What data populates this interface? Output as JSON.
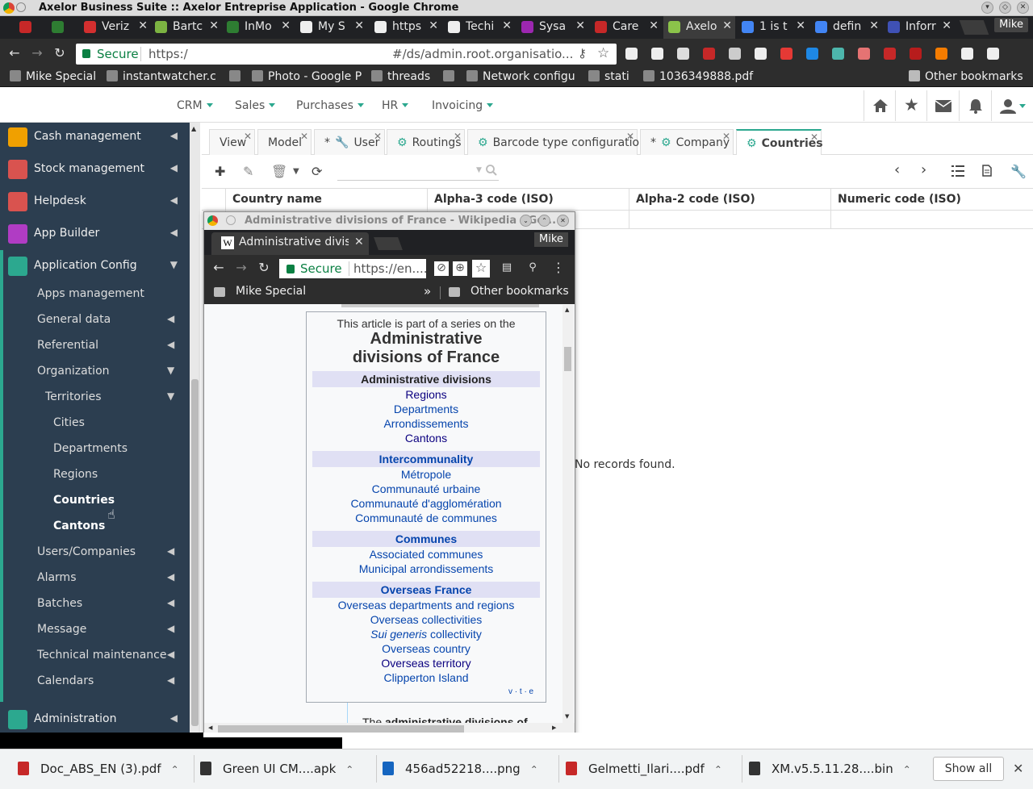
{
  "window": {
    "title": "Axelor Business Suite :: Axelor Entreprise Application - Google Chrome"
  },
  "browser_tabs": [
    {
      "label": "",
      "icon": "gmail-icon",
      "color": "#c62828"
    },
    {
      "label": "",
      "icon": "hangouts-icon",
      "color": "#2e7d32"
    },
    {
      "label": "Veriz",
      "icon": "verizon-icon",
      "color": "#d32f2f"
    },
    {
      "label": "Bartc",
      "icon": "figure-icon",
      "color": "#7cb342"
    },
    {
      "label": "InMo",
      "icon": "inmo-icon",
      "color": "#2e7d32"
    },
    {
      "label": "My S",
      "icon": "briefcase-icon",
      "color": "#eeeeee"
    },
    {
      "label": "https",
      "icon": "page-icon",
      "color": "#eeeeee"
    },
    {
      "label": "Techi",
      "icon": "briefcase-icon",
      "color": "#eeeeee"
    },
    {
      "label": "Sysa",
      "icon": "sysaid-icon",
      "color": "#9c27b0"
    },
    {
      "label": "Care",
      "icon": "info-icon",
      "color": "#c62828"
    },
    {
      "label": "Axelo",
      "icon": "axelor-icon",
      "color": "#8bc34a"
    },
    {
      "label": "1 is t",
      "icon": "google-icon",
      "color": "#4285f4"
    },
    {
      "label": "defin",
      "icon": "google-icon",
      "color": "#4285f4"
    },
    {
      "label": "Inforr",
      "icon": "page-icon",
      "color": "#3f51b5"
    }
  ],
  "profile": "Mike",
  "omnibox": {
    "secure": "Secure",
    "url": "https:/",
    "path": "#/ds/admin.root.organisatio..."
  },
  "bookmarks": [
    {
      "label": "Mike Special",
      "icon": "folder-icon"
    },
    {
      "label": "instantwatcher.c",
      "icon": "w-icon"
    },
    {
      "label": "",
      "icon": "pinwheel-icon"
    },
    {
      "label": "Photo - Google P",
      "icon": "photos-icon"
    },
    {
      "label": "threads",
      "icon": "threads-icon"
    },
    {
      "label": "",
      "icon": "cisco-icon"
    },
    {
      "label": "Network configu",
      "icon": "network-icon"
    },
    {
      "label": "stati",
      "icon": "bug-icon"
    },
    {
      "label": "1036349888.pdf",
      "icon": "page-icon"
    }
  ],
  "other_bookmarks": "Other bookmarks",
  "app_menu": [
    "CRM",
    "Sales",
    "Purchases",
    "HR",
    "Invoicing"
  ],
  "sidebar_top": [
    {
      "label": "Cash management",
      "color": "#f0a000",
      "arrow": "◀"
    },
    {
      "label": "Stock management",
      "color": "#d9534f",
      "arrow": "◀"
    },
    {
      "label": "Helpdesk",
      "color": "#d9534f",
      "arrow": "◀"
    },
    {
      "label": "App Builder",
      "color": "#b03cc4",
      "arrow": "◀"
    },
    {
      "label": "Application Config",
      "color": "#2ca88f",
      "arrow": "▼"
    }
  ],
  "sidebar_sub": [
    {
      "label": "Apps management",
      "indent": 1,
      "arrow": ""
    },
    {
      "label": "General data",
      "indent": 1,
      "arrow": "◀"
    },
    {
      "label": "Referential",
      "indent": 1,
      "arrow": "◀"
    },
    {
      "label": "Organization",
      "indent": 1,
      "arrow": "▼"
    },
    {
      "label": "Territories",
      "indent": 2,
      "arrow": "▼"
    },
    {
      "label": "Cities",
      "indent": 3,
      "arrow": ""
    },
    {
      "label": "Departments",
      "indent": 3,
      "arrow": ""
    },
    {
      "label": "Regions",
      "indent": 3,
      "arrow": ""
    },
    {
      "label": "Countries",
      "indent": 3,
      "arrow": "",
      "bold": true
    },
    {
      "label": "Cantons",
      "indent": 3,
      "arrow": "",
      "bold": true
    },
    {
      "label": "Users/Companies",
      "indent": 1,
      "arrow": "◀"
    },
    {
      "label": "Alarms",
      "indent": 1,
      "arrow": "◀"
    },
    {
      "label": "Batches",
      "indent": 1,
      "arrow": "◀"
    },
    {
      "label": "Message",
      "indent": 1,
      "arrow": "◀"
    },
    {
      "label": "Technical maintenance",
      "indent": 1,
      "arrow": "◀"
    },
    {
      "label": "Calendars",
      "indent": 1,
      "arrow": "◀"
    }
  ],
  "sidebar_bottom": {
    "label": "Administration",
    "arrow": "◀"
  },
  "view_tabs": [
    {
      "label": "View",
      "prefix": "",
      "gear": false
    },
    {
      "label": "Model",
      "prefix": "",
      "gear": false
    },
    {
      "label": "User",
      "prefix": "*",
      "gear": false,
      "wrench": true
    },
    {
      "label": "Routings",
      "prefix": "",
      "gear": true
    },
    {
      "label": "Barcode type configuration",
      "prefix": "",
      "gear": true
    },
    {
      "label": "Company",
      "prefix": "*",
      "gear": true
    },
    {
      "label": "Countries",
      "prefix": "",
      "gear": true,
      "active": true
    }
  ],
  "grid": {
    "columns": [
      "Country name",
      "Alpha-3 code (ISO)",
      "Alpha-2 code (ISO)",
      "Numeric code (ISO)"
    ],
    "empty": "No records found."
  },
  "popup": {
    "title": "Administrative divisions of France - Wikipedia - Go...",
    "tab": "Administrative divisions of France",
    "profile": "Mike",
    "secure": "Secure",
    "url": "https://en....",
    "bookmark": "Mike Special",
    "more": "»",
    "other_bookmarks": "Other bookmarks",
    "infobox": {
      "intro": "This article is part of a series on the",
      "title1": "Administrative",
      "title2": "divisions of France",
      "sections": [
        {
          "heading": "Administrative divisions",
          "heading_link": false,
          "items": [
            {
              "t": "Regions",
              "v": true
            },
            {
              "t": "Departments",
              "v": false
            },
            {
              "t": "Arrondissements",
              "v": false
            },
            {
              "t": "Cantons",
              "v": true
            }
          ]
        },
        {
          "heading": "Intercommunality",
          "heading_link": true,
          "items": [
            {
              "t": "Métropole",
              "v": false
            },
            {
              "t": "Communauté urbaine",
              "v": false
            },
            {
              "t": "Communauté d'agglomération",
              "v": false
            },
            {
              "t": "Communauté de communes",
              "v": false
            }
          ]
        },
        {
          "heading": "Communes",
          "heading_link": true,
          "items": [
            {
              "t": "Associated communes",
              "v": false
            },
            {
              "t": "Municipal arrondissements",
              "v": false
            }
          ]
        },
        {
          "heading": "Overseas France",
          "heading_link": true,
          "items": [
            {
              "t": "Overseas departments and regions",
              "v": false
            },
            {
              "t": "Overseas collectivities",
              "v": false
            },
            {
              "t": "Sui generis collectivity",
              "v": false,
              "italic_part": "Sui generis"
            },
            {
              "t": "Overseas country",
              "v": false
            },
            {
              "t": "Overseas territory",
              "v": true
            },
            {
              "t": "Clipperton Island",
              "v": false
            }
          ]
        }
      ],
      "vte": "v · t · e"
    },
    "body_text_pre": "The ",
    "body_text_bold": "administrative divisions of"
  },
  "downloads": [
    {
      "name": "Doc_ABS_EN (3).pdf",
      "color": "#c62828"
    },
    {
      "name": "Green UI CM....apk",
      "color": "#333333"
    },
    {
      "name": "456ad52218....png",
      "color": "#1565c0"
    },
    {
      "name": "Gelmetti_Ilari....pdf",
      "color": "#c62828"
    },
    {
      "name": "XM.v5.5.11.28....bin",
      "color": "#333333"
    }
  ],
  "show_all": "Show all"
}
